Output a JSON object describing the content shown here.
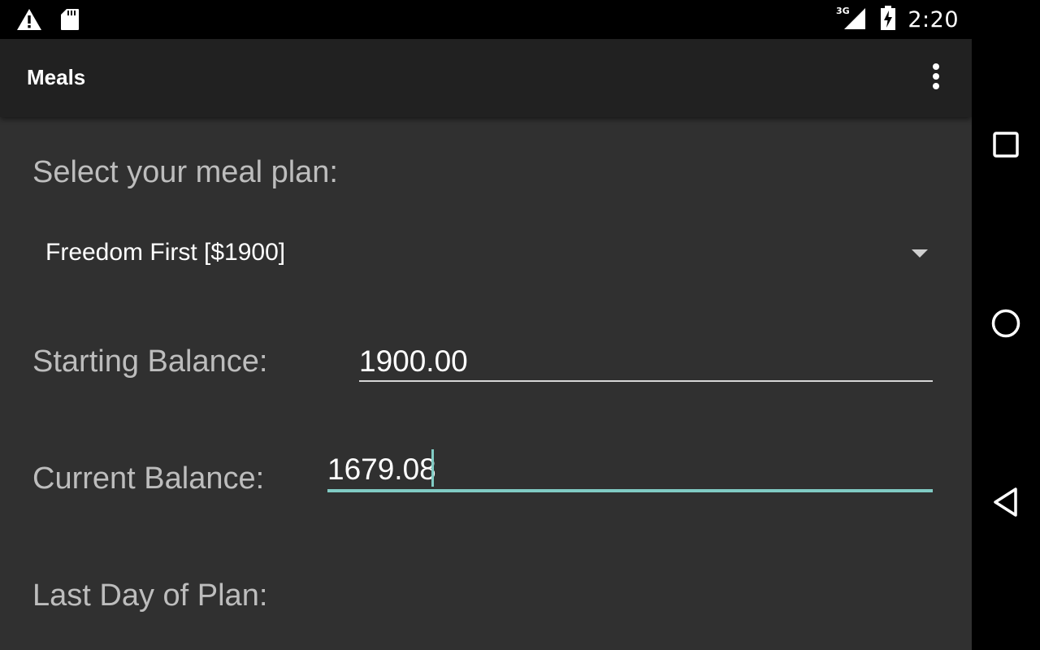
{
  "status_bar": {
    "time": "2:20",
    "network_type": "3G",
    "icons": [
      "warning-icon",
      "sd-card-icon",
      "signal-icon",
      "battery-charging-icon"
    ]
  },
  "toolbar": {
    "title": "Meals",
    "overflow_icon": "more-vert-icon"
  },
  "form": {
    "meal_plan_label": "Select your meal plan:",
    "meal_plan_selected": "Freedom First [$1900]",
    "starting_balance_label": "Starting Balance:",
    "starting_balance_value": "1900.00",
    "current_balance_label": "Current Balance:",
    "current_balance_value": "1679.08",
    "last_day_label": "Last Day of Plan:"
  },
  "nav_bar": {
    "icons": [
      "recents-icon",
      "home-icon",
      "back-icon"
    ]
  },
  "colors": {
    "background": "#303030",
    "toolbar": "#212121",
    "accent": "#80cbc4",
    "label_text": "#bdbdbd",
    "value_text": "#ffffff"
  }
}
